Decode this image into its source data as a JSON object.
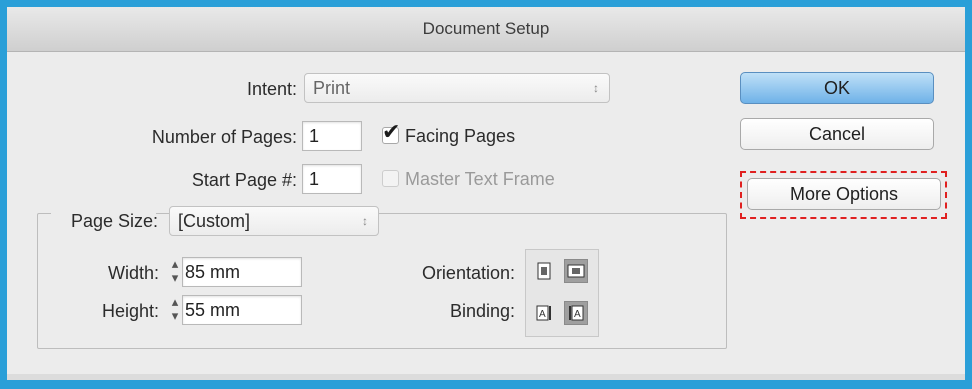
{
  "colors": {
    "frame": "#2a9fd8",
    "primary_button": "#6fb2e8",
    "highlight_dashes": "#e02020"
  },
  "dialog": {
    "title": "Document Setup"
  },
  "intent": {
    "label": "Intent:",
    "value": "Print"
  },
  "pages": {
    "label": "Number of Pages:",
    "value": "1",
    "facing_label": "Facing Pages",
    "facing_checked": true
  },
  "start_page": {
    "label": "Start Page #:",
    "value": "1",
    "master_label": "Master Text Frame",
    "master_checked": false
  },
  "page_size": {
    "label": "Page Size:",
    "value": "[Custom]"
  },
  "width": {
    "label": "Width:",
    "value": "85 mm"
  },
  "height": {
    "label": "Height:",
    "value": "55 mm"
  },
  "orientation": {
    "label": "Orientation:",
    "icons": [
      "portrait-icon",
      "landscape-icon"
    ],
    "selected": "landscape-icon"
  },
  "binding": {
    "label": "Binding:",
    "icons": [
      "left-to-right-binding-icon",
      "right-to-left-binding-icon"
    ],
    "selected": "right-to-left-binding-icon"
  },
  "buttons": {
    "ok": "OK",
    "cancel": "Cancel",
    "more_options": "More Options"
  }
}
